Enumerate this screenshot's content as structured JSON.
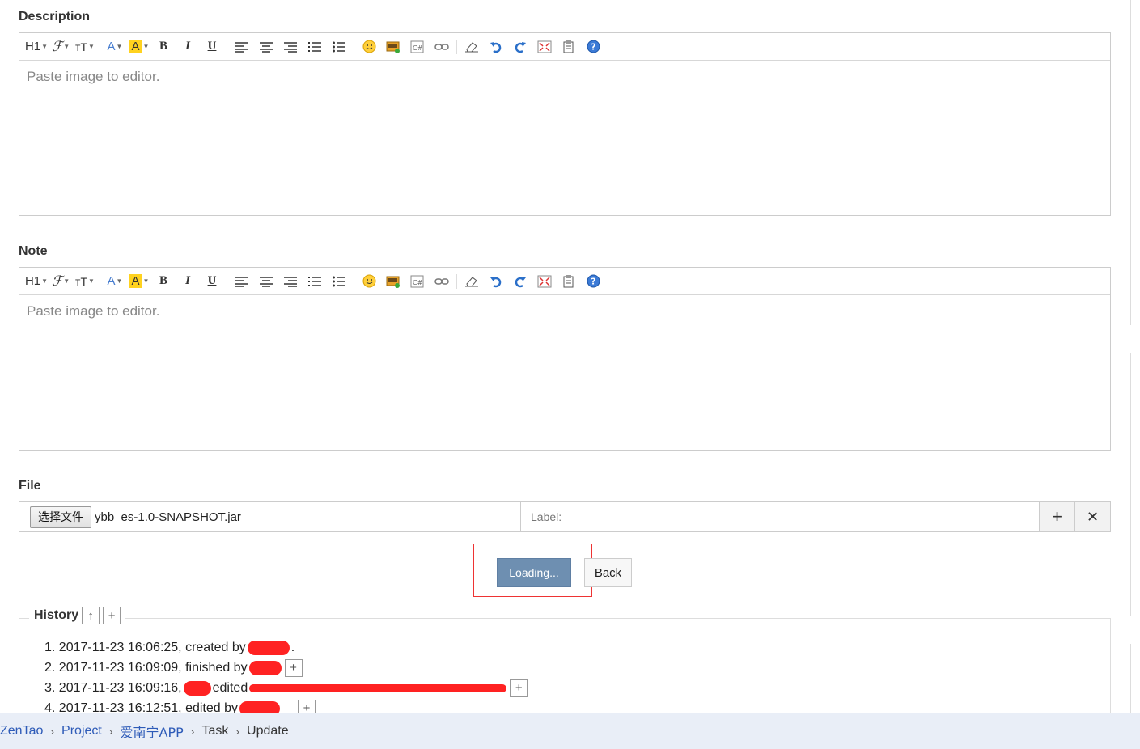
{
  "description": {
    "label": "Description",
    "placeholder": "Paste image to editor."
  },
  "note": {
    "label": "Note",
    "placeholder": "Paste image to editor."
  },
  "toolbar": {
    "heading": "H1",
    "font": "ℱ",
    "size": "тT",
    "forecolor": "A",
    "backcolor": "A",
    "bold": "B",
    "italic": "I",
    "underline": "U",
    "icons": [
      "align-left-icon",
      "align-center-icon",
      "align-right-icon",
      "ordered-list-icon",
      "unordered-list-icon",
      "emoticon-icon",
      "image-icon",
      "code-icon",
      "link-icon",
      "eraser-icon",
      "undo-icon",
      "redo-icon",
      "fullscreen-icon",
      "paste-icon",
      "help-icon"
    ]
  },
  "file": {
    "label": "File",
    "choose_button": "选择文件",
    "file_name": "ybb_es-1.0-SNAPSHOT.jar",
    "label_placeholder": "Label:",
    "add": "+",
    "remove": "✕"
  },
  "actions": {
    "loading": "Loading...",
    "back": "Back"
  },
  "history": {
    "title": "History",
    "items": [
      {
        "num": "1.",
        "text": "2017-11-23 16:06:25, created by",
        "suffix": "."
      },
      {
        "num": "2.",
        "text": "2017-11-23 16:09:09, finished by",
        "suffix": ""
      },
      {
        "num": "3.",
        "text": "2017-11-23 16:09:16,",
        "suffix": "edited"
      },
      {
        "num": "4.",
        "text": "2017-11-23 16:12:51, edited by",
        "suffix": ""
      }
    ]
  },
  "breadcrumb": {
    "items": [
      "ZenTao",
      "Project",
      "爱南宁APP",
      "Task",
      "Update"
    ]
  }
}
